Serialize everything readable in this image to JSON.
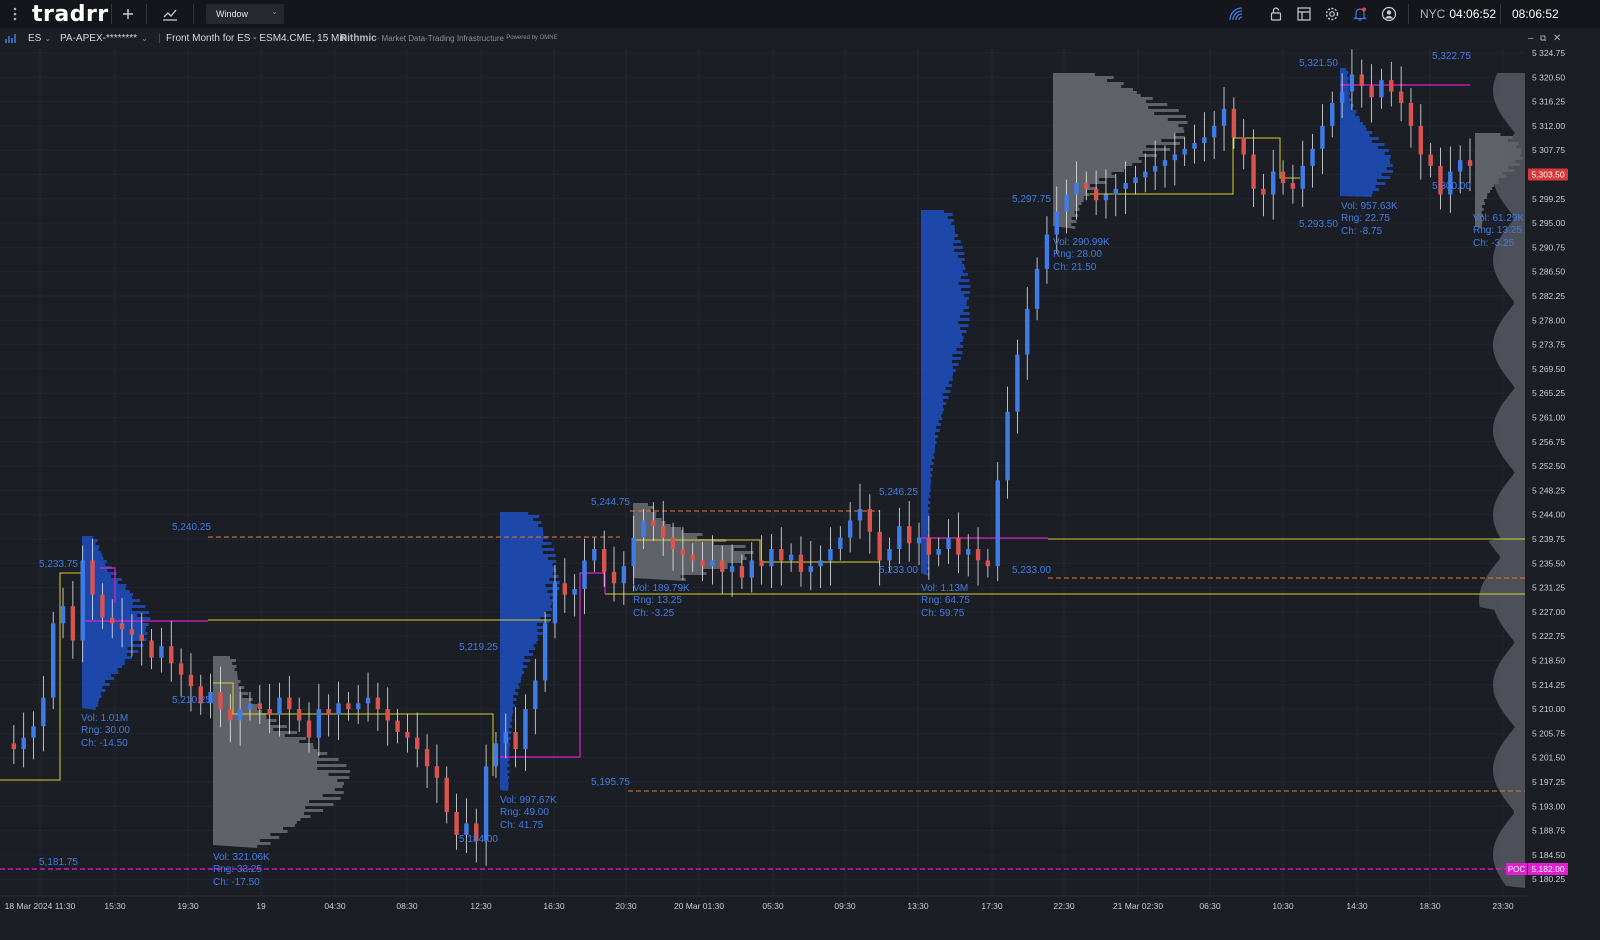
{
  "app": {
    "logo": "tradrr",
    "window_select": "Window",
    "clock_city": "NYC",
    "clock_city_time": "04:06:52",
    "clock_local": "08:06:52"
  },
  "toolbar": {
    "menu_icon": "kebab-menu-icon",
    "add_icon": "plus-icon",
    "chart_icon": "chart-line-icon",
    "right_icons": [
      "signal-icon",
      "unlock-icon",
      "layout-icon",
      "settings-icon",
      "bell-icon",
      "user-icon"
    ]
  },
  "instrument_bar": {
    "symbol": "ES",
    "account": "PA-APEX-********",
    "description": "Front Month for ES - ESM4.CME, 15 Min",
    "data_provider": "Rithmic",
    "data_provider_tagline": "· Market Data-Trading Infrastructure",
    "powered_by": "Powered by OMNE"
  },
  "colors": {
    "background": "#1b1e25",
    "up": "#3f7ce6",
    "down": "#d9534f",
    "profile_blue": "#1f4fc2",
    "profile_gray": "#6b6e75",
    "poc_magenta": "#e020d0",
    "yellow": "#d8cf2a",
    "orange": "#e07a3a",
    "label_blue": "#3f7ce6"
  },
  "chart_data": {
    "type": "candlestick",
    "price_axis_labels": [
      "5 324.75",
      "5 320.50",
      "5 316.25",
      "5 312.00",
      "5 307.75",
      "5 303.50",
      "5 299.25",
      "5 295.00",
      "5 290.75",
      "5 286.50",
      "5 282.25",
      "5 278.00",
      "5 273.75",
      "5 269.50",
      "5 265.25",
      "5 261.00",
      "5 256.75",
      "5 252.50",
      "5 248.25",
      "5 244.00",
      "5 239.75",
      "5 235.50",
      "5 231.25",
      "5 227.00",
      "5 222.75",
      "5 218.50",
      "5 214.25",
      "5 210.00",
      "5 205.75",
      "5 201.50",
      "5 197.25",
      "5 193.00",
      "5 188.75",
      "5 184.50",
      "5 180.25"
    ],
    "time_axis_labels": [
      "18 Mar 2024 11:30",
      "15:30",
      "19:30",
      "19",
      "04:30",
      "08:30",
      "12:30",
      "16:30",
      "20:30",
      "20 Mar 01:30",
      "05:30",
      "09:30",
      "13:30",
      "17:30",
      "22:30",
      "21 Mar 02:30",
      "06:30",
      "10:30",
      "14:30",
      "18:30",
      "23:30"
    ],
    "current_price": "5,303.50",
    "poc_tag": {
      "label": "POC",
      "price": "5,182.00"
    },
    "price_level_labels": [
      "5,240.25",
      "5,233.75",
      "5,210.25",
      "5,219.25",
      "5,184.00",
      "5,195.75",
      "5,244.75",
      "5,246.25",
      "5,233.00",
      "5,233.00",
      "5,297.75",
      "5,321.50",
      "5,293.50",
      "5,322.75",
      "5,300.00",
      "5,181.75"
    ],
    "sessions": [
      {
        "vol": "Vol: 1.01M",
        "rng": "Rng: 30.00",
        "ch": "Ch: -14.50"
      },
      {
        "vol": "Vol: 321.06K",
        "rng": "Rng: 33.25",
        "ch": "Ch: -17.50"
      },
      {
        "vol": "Vol: 997.67K",
        "rng": "Rng: 49.00",
        "ch": "Ch: 41.75"
      },
      {
        "vol": "Vol: 189.79K",
        "rng": "Rng: 13.25",
        "ch": "Ch: -3.25"
      },
      {
        "vol": "Vol: 1.13M",
        "rng": "Rng: 64.75",
        "ch": "Ch: 59.75"
      },
      {
        "vol": "Vol: 290.99K",
        "rng": "Rng: 28.00",
        "ch": "Ch: 21.50"
      },
      {
        "vol": "Vol: 957.63K",
        "rng": "Rng: 22.75",
        "ch": "Ch: -8.75"
      },
      {
        "vol": "Vol: 61.29K",
        "rng": "Rng: 13.25",
        "ch": "Ch: -3.25"
      }
    ],
    "close_path": [
      5204,
      5203,
      5205,
      5207,
      5212,
      5225,
      5228,
      5222,
      5236,
      5230,
      5226,
      5225,
      5224,
      5223,
      5222,
      5219,
      5221,
      5218,
      5216,
      5214,
      5211,
      5213,
      5210,
      5208,
      5210,
      5211,
      5210,
      5209,
      5212,
      5210,
      5208,
      5205,
      5210,
      5209,
      5211,
      5210,
      5211,
      5212,
      5210,
      5208,
      5206,
      5205,
      5203,
      5200,
      5198,
      5192,
      5188,
      5190,
      5187,
      5200,
      5204,
      5206,
      5203,
      5210,
      5215,
      5225,
      5232,
      5230,
      5231,
      5236,
      5238,
      5234,
      5232,
      5235,
      5240,
      5243,
      5242,
      5240,
      5238,
      5237,
      5236,
      5235,
      5236,
      5234,
      5235,
      5233,
      5236,
      5235,
      5238,
      5236,
      5237,
      5234,
      5235,
      5236,
      5238,
      5240,
      5243,
      5245,
      5241,
      5236,
      5238,
      5242,
      5239,
      5240,
      5237,
      5238,
      5240,
      5237,
      5238,
      5236,
      5235,
      5250,
      5262,
      5272,
      5280,
      5287,
      5293,
      5297,
      5300,
      5302,
      5301,
      5299,
      5300,
      5301,
      5302,
      5303,
      5304,
      5305,
      5306,
      5307,
      5308,
      5309,
      5310,
      5312,
      5315,
      5310,
      5307,
      5301,
      5300,
      5304,
      5302,
      5301,
      5305,
      5308,
      5312,
      5316,
      5318,
      5321,
      5319,
      5317,
      5320,
      5318,
      5316,
      5312,
      5307,
      5305,
      5300,
      5304,
      5306,
      5305
    ]
  }
}
